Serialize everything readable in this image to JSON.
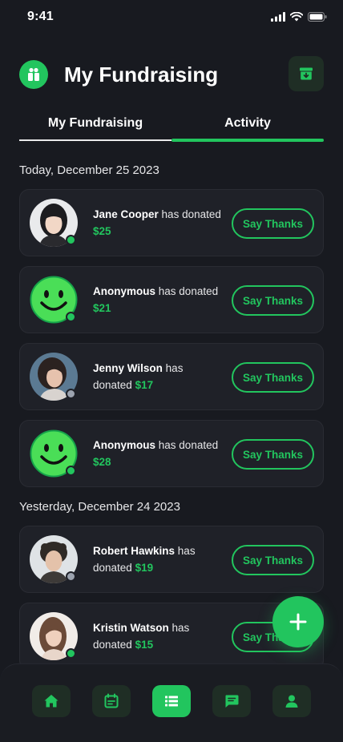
{
  "status_bar": {
    "time": "9:41"
  },
  "header": {
    "title": "My Fundraising"
  },
  "tabs": [
    {
      "label": "My Fundraising",
      "active": false
    },
    {
      "label": "Activity",
      "active": true
    }
  ],
  "sections": [
    {
      "label": "Today, December 25 2023",
      "items": [
        {
          "donor": "Jane Cooper",
          "text": "has donated",
          "amount": "$25",
          "avatar": "photo-woman-dark-hair",
          "online": true,
          "button": "Say Thanks"
        },
        {
          "donor": "Anonymous",
          "text": "has donated",
          "amount": "$21",
          "avatar": "smiley-face-icon",
          "online": true,
          "button": "Say Thanks"
        },
        {
          "donor": "Jenny Wilson",
          "text": "has donated",
          "amount": "$17",
          "avatar": "photo-woman-blue-bg",
          "online": false,
          "button": "Say Thanks"
        },
        {
          "donor": "Anonymous",
          "text": "has donated",
          "amount": "$28",
          "avatar": "smiley-face-icon",
          "online": true,
          "button": "Say Thanks"
        }
      ]
    },
    {
      "label": "Yesterday, December 24 2023",
      "items": [
        {
          "donor": "Robert Hawkins",
          "text": "has donated",
          "amount": "$19",
          "avatar": "photo-man-curly-hair",
          "online": false,
          "button": "Say Thanks"
        },
        {
          "donor": "Kristin Watson",
          "text": "has donated",
          "amount": "$15",
          "avatar": "photo-woman-light-bg",
          "online": true,
          "button": "Say Thanks"
        }
      ]
    }
  ],
  "fab": {
    "icon": "plus-icon"
  },
  "bottom_nav": [
    {
      "icon": "home-icon",
      "active": false
    },
    {
      "icon": "calendar-icon",
      "active": false
    },
    {
      "icon": "list-icon",
      "active": true
    },
    {
      "icon": "chat-icon",
      "active": false
    },
    {
      "icon": "profile-icon",
      "active": false
    }
  ],
  "colors": {
    "background": "#181a20",
    "card": "#1f2128",
    "accent": "#22c55e",
    "offline": "#9ca3af"
  }
}
